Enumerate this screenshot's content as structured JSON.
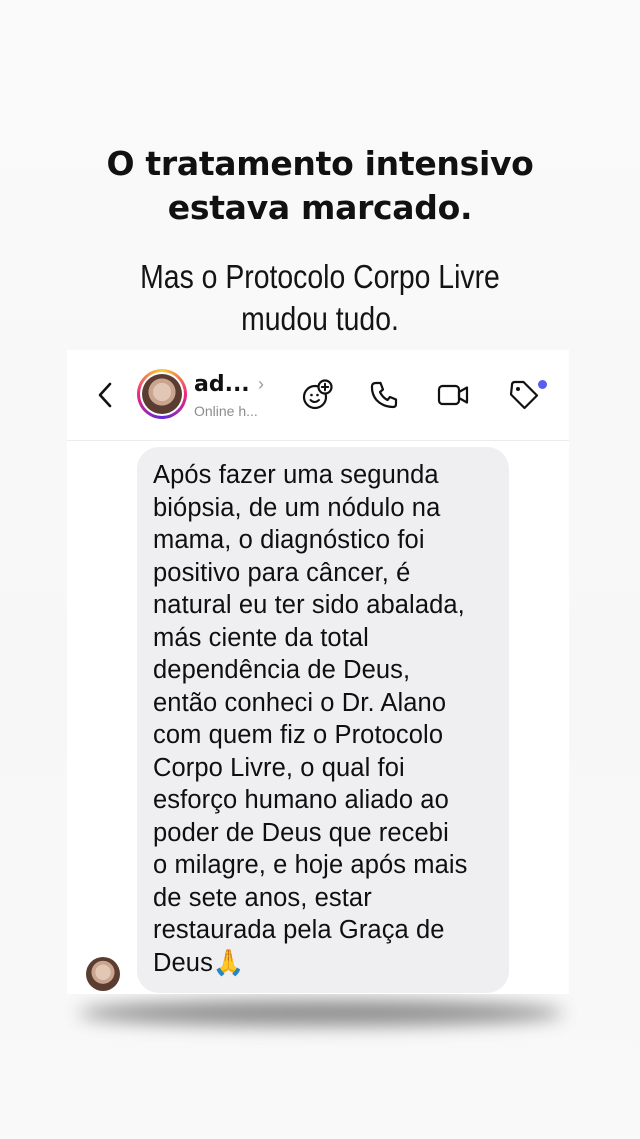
{
  "headline": {
    "line1": "O tratamento intensivo",
    "line2": "estava marcado."
  },
  "subheadline": {
    "line1": "Mas o Protocolo Corpo Livre",
    "line2": "mudou tudo."
  },
  "chat_header": {
    "back_icon": "chevron-left-icon",
    "user_name": "ad...",
    "name_chevron": "›",
    "status": "Online h...",
    "icons": [
      "sticker-add-icon",
      "phone-icon",
      "video-camera-icon",
      "tag-icon"
    ],
    "tag_dot_color": "#5b5bf0"
  },
  "message": {
    "lines": [
      "Após fazer uma segunda",
      "biópsia, de um nódulo na",
      "mama, o diagnóstico foi",
      "positivo para câncer, é",
      "natural eu ter sido abalada,",
      "más ciente da total",
      "dependência de Deus,",
      "então conheci o Dr. Alano",
      "com quem fiz o Protocolo",
      "Corpo Livre, o qual foi",
      "esforço humano aliado ao",
      "poder de Deus que recebi",
      "o milagre, e hoje após mais",
      "de sete anos, estar",
      "restaurada pela Graça de",
      "Deus🙏"
    ],
    "bubble_color": "#efeff1"
  }
}
